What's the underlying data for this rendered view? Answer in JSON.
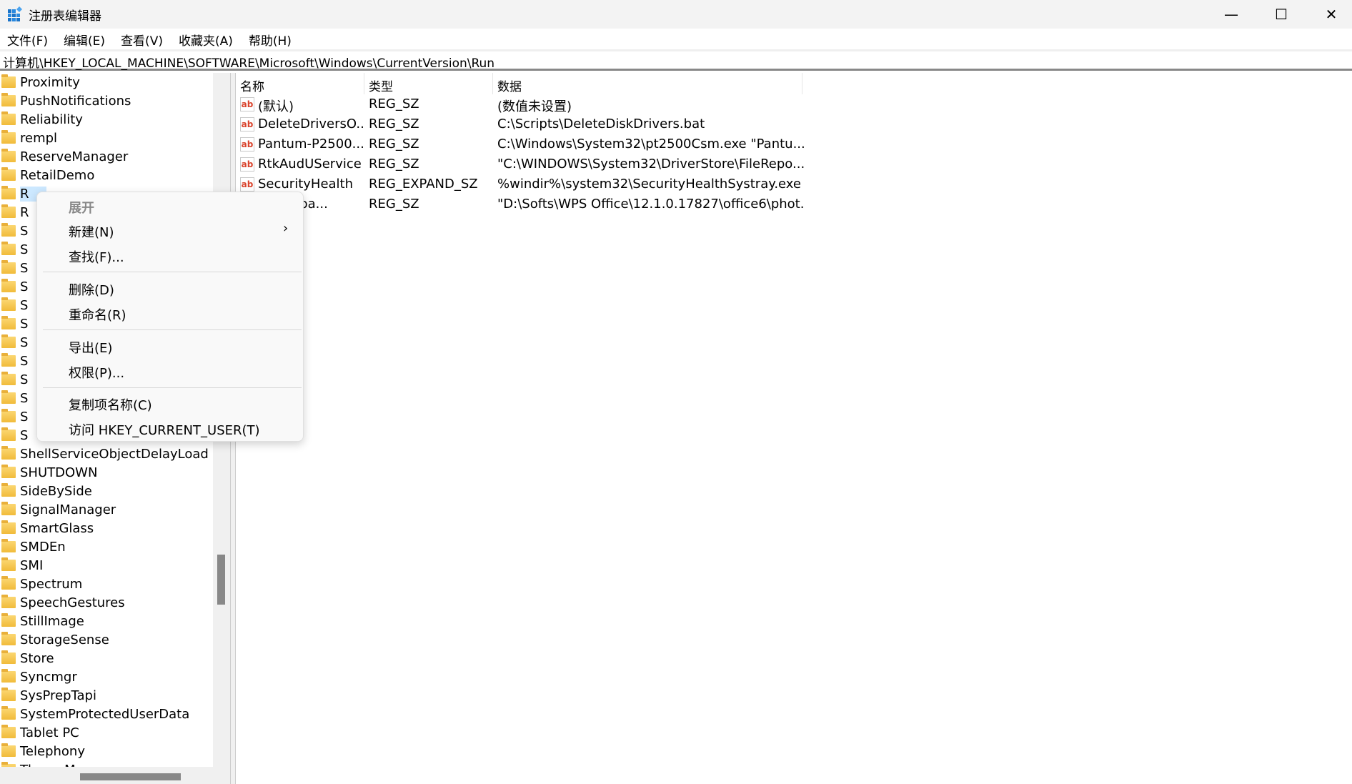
{
  "window": {
    "title": "注册表编辑器",
    "minimize": "—",
    "maximize": "☐",
    "close": "✕"
  },
  "menubar": [
    "文件(F)",
    "编辑(E)",
    "查看(V)",
    "收藏夹(A)",
    "帮助(H)"
  ],
  "address": "计算机\\HKEY_LOCAL_MACHINE\\SOFTWARE\\Microsoft\\Windows\\CurrentVersion\\Run",
  "tree": {
    "selected_index": 6,
    "items": [
      "Proximity",
      "PushNotifications",
      "Reliability",
      "rempl",
      "ReserveManager",
      "RetailDemo",
      "R",
      "R",
      "S",
      "S",
      "S",
      "S",
      "S",
      "S",
      "S",
      "S",
      "S",
      "S",
      "S",
      "S",
      "ShellServiceObjectDelayLoad",
      "SHUTDOWN",
      "SideBySide",
      "SignalManager",
      "SmartGlass",
      "SMDEn",
      "SMI",
      "Spectrum",
      "SpeechGestures",
      "StillImage",
      "StorageSense",
      "Store",
      "Syncmgr",
      "SysPrepTapi",
      "SystemProtectedUserData",
      "Tablet PC",
      "Telephony",
      "ThemeM"
    ]
  },
  "list": {
    "headers": {
      "name": "名称",
      "type": "类型",
      "data": "数据"
    },
    "rows": [
      {
        "name": "(默认)",
        "type": "REG_SZ",
        "data": "(数值未设置)"
      },
      {
        "name": "DeleteDriversO...",
        "type": "REG_SZ",
        "data": "C:\\Scripts\\DeleteDiskDrivers.bat"
      },
      {
        "name": "Pantum-P2500...",
        "type": "REG_SZ",
        "data": "C:\\Windows\\System32\\pt2500Csm.exe \"Pantu..."
      },
      {
        "name": "RtkAudUService",
        "type": "REG_SZ",
        "data": "\"C:\\WINDOWS\\System32\\DriverStore\\FileRepo..."
      },
      {
        "name": "SecurityHealth",
        "type": "REG_EXPAND_SZ",
        "data": "%windir%\\system32\\SecurityHealthSystray.exe"
      },
      {
        "name": "otoautoa...",
        "type": "REG_SZ",
        "data": "\"D:\\Softs\\WPS Office\\12.1.0.17827\\office6\\phot..."
      }
    ],
    "value_icon": "ab"
  },
  "context_menu": {
    "expand": "展开",
    "new": "新建(N)",
    "find": "查找(F)...",
    "delete": "删除(D)",
    "rename": "重命名(R)",
    "export": "导出(E)",
    "permissions": "权限(P)...",
    "copy_key_name": "复制项名称(C)",
    "goto_hkcu": "访问 HKEY_CURRENT_USER(T)"
  }
}
